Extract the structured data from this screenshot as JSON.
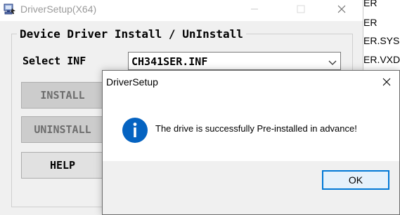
{
  "main_window": {
    "title": "DriverSetup(X64)",
    "group_caption": "Device Driver Install / UnInstall",
    "select_label": "Select INF",
    "select_value": "CH341SER.INF",
    "buttons": {
      "install": "INSTALL",
      "uninstall": "UNINSTALL",
      "help": "HELP"
    }
  },
  "background_files": [
    "ER",
    "ER",
    "ER.SYS",
    "ER.VXD"
  ],
  "dialog": {
    "title": "DriverSetup",
    "icon": "info-icon",
    "message": "The drive is successfully Pre-installed in advance!",
    "ok_label": "OK"
  },
  "colors": {
    "accent": "#0078d7",
    "info_icon": "#0563c1",
    "disabled_button": "#cccccc"
  }
}
